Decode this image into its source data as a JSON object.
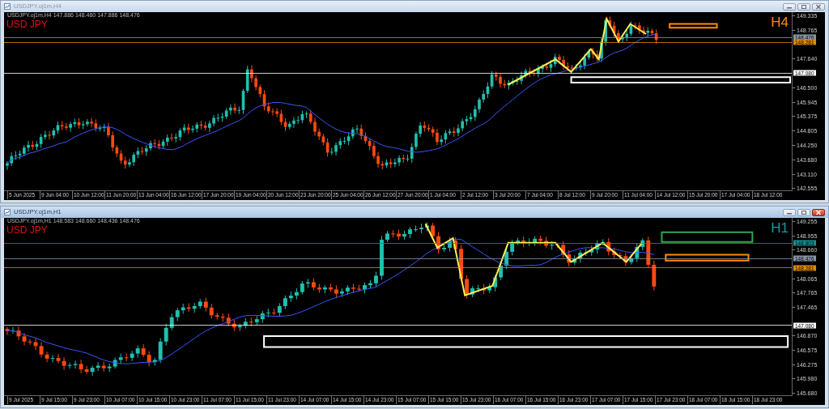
{
  "windows": [
    {
      "title": "USDJPY.oj1m,H4",
      "active": false,
      "header": "USDJPY.oj1m,H4  147.886 148.460 147.886 148.476",
      "symbol": "USD JPY",
      "timeframe": {
        "text": "H4",
        "color": "#ff8c00"
      },
      "price_labels": [
        "149.335",
        "148.765",
        "147.640",
        "146.500",
        "145.945",
        "145.375",
        "144.805",
        "144.250",
        "143.680",
        "143.110",
        "142.555"
      ],
      "price_tags": [
        {
          "text": "148.476",
          "color": "#8796a8"
        },
        {
          "text": "148.281",
          "color": "#e08a00"
        },
        {
          "text": "147.080",
          "color": "#ffffff"
        }
      ],
      "time_labels": [
        "5 Jun 2025",
        "9 Jun 04:00",
        "10 Jun 12:00",
        "11 Jun 20:00",
        "13 Jun 04:00",
        "16 Jun 12:00",
        "17 Jun 20:00",
        "19 Jun 04:00",
        "20 Jun 12:00",
        "23 Jun 20:00",
        "25 Jun 04:00",
        "26 Jun 12:00",
        "27 Jun 20:00",
        "1 Jul 04:00",
        "2 Jul 12:00",
        "3 Jul 20:00",
        "7 Jul 04:00",
        "8 Jul 12:00",
        "9 Jul 20:00",
        "11 Jul 04:00",
        "14 Jul 12:00",
        "15 Jul 20:00",
        "17 Jul 04:00",
        "18 Jul 12:00"
      ]
    },
    {
      "title": "USDJPY.oj1m,H1",
      "active": true,
      "header": "USDJPY.oj1m,H1  148.583 148.660 148.436 148.476",
      "symbol": "USD JPY",
      "timeframe": {
        "text": "H1",
        "color": "#1a9c9c"
      },
      "price_labels": [
        "149.255",
        "148.955",
        "148.660",
        "148.065",
        "147.765",
        "147.465",
        "146.870",
        "146.575",
        "146.275",
        "145.980",
        "145.680"
      ],
      "price_tags": [
        {
          "text": "148.803",
          "color": "#1a8f8f"
        },
        {
          "text": "148.476",
          "color": "#8796a8"
        },
        {
          "text": "148.281",
          "color": "#e08a00"
        },
        {
          "text": "147.080",
          "color": "#ffffff"
        }
      ],
      "time_labels": [
        "9 Jul 2025",
        "9 Jul 15:00",
        "9 Jul 23:00",
        "10 Jul 07:00",
        "10 Jul 15:00",
        "10 Jul 23:00",
        "11 Jul 07:00",
        "11 Jul 15:00",
        "11 Jul 23:00",
        "14 Jul 07:00",
        "14 Jul 15:00",
        "14 Jul 23:00",
        "15 Jul 07:00",
        "15 Jul 15:00",
        "15 Jul 23:00",
        "16 Jul 07:00",
        "16 Jul 15:00",
        "16 Jul 23:00",
        "17 Jul 07:00",
        "17 Jul 15:00",
        "17 Jul 23:00",
        "18 Jul 07:00",
        "18 Jul 15:00",
        "18 Jul 23:00"
      ]
    }
  ]
}
